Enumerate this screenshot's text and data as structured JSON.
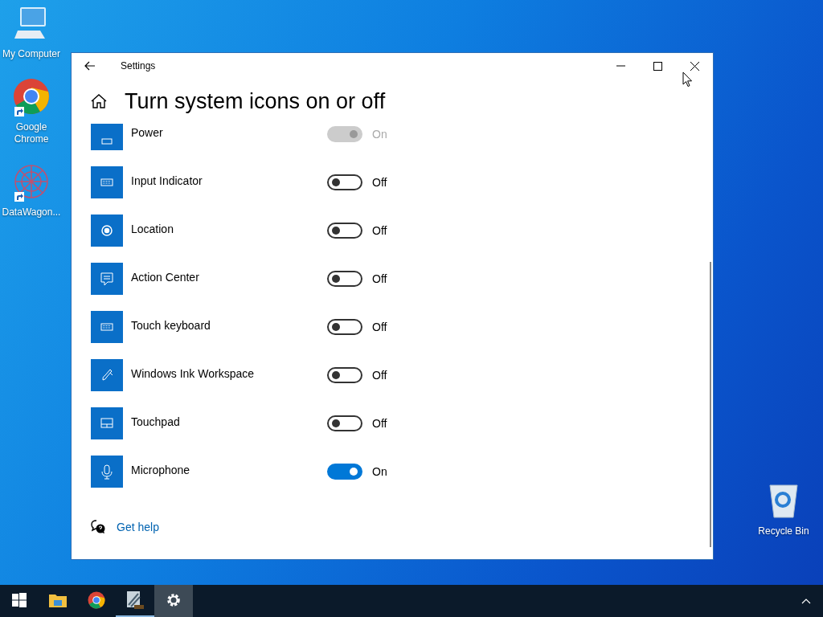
{
  "desktop": {
    "left_icons": [
      {
        "kind": "computer",
        "label": "My Computer",
        "shortcut": false
      },
      {
        "kind": "chrome",
        "label": "Google Chrome",
        "shortcut": true
      },
      {
        "kind": "app",
        "label": "DataWagon...",
        "shortcut": true
      }
    ],
    "right_icons": [
      {
        "kind": "recycle",
        "label": "Recycle Bin",
        "shortcut": false
      }
    ]
  },
  "window": {
    "title": "Settings",
    "page_title": "Turn system icons on or off",
    "items": [
      {
        "kind": "power",
        "name": "Power",
        "on": true,
        "disabled": true,
        "state_label": "On"
      },
      {
        "kind": "keyboard",
        "name": "Input Indicator",
        "on": false,
        "disabled": false,
        "state_label": "Off"
      },
      {
        "kind": "location",
        "name": "Location",
        "on": false,
        "disabled": false,
        "state_label": "Off"
      },
      {
        "kind": "action",
        "name": "Action Center",
        "on": false,
        "disabled": false,
        "state_label": "Off"
      },
      {
        "kind": "keyboard",
        "name": "Touch keyboard",
        "on": false,
        "disabled": false,
        "state_label": "Off"
      },
      {
        "kind": "pen",
        "name": "Windows Ink Workspace",
        "on": false,
        "disabled": false,
        "state_label": "Off"
      },
      {
        "kind": "touchpad",
        "name": "Touchpad",
        "on": false,
        "disabled": false,
        "state_label": "Off"
      },
      {
        "kind": "mic",
        "name": "Microphone",
        "on": true,
        "disabled": false,
        "state_label": "On"
      }
    ],
    "help_link": "Get help"
  },
  "taskbar": {
    "items": [
      {
        "kind": "start",
        "selected": false,
        "running": false
      },
      {
        "kind": "explorer",
        "selected": false,
        "running": false
      },
      {
        "kind": "chrome",
        "selected": false,
        "running": false
      },
      {
        "kind": "app",
        "selected": false,
        "running": true
      },
      {
        "kind": "settings",
        "selected": true,
        "running": false
      }
    ]
  }
}
